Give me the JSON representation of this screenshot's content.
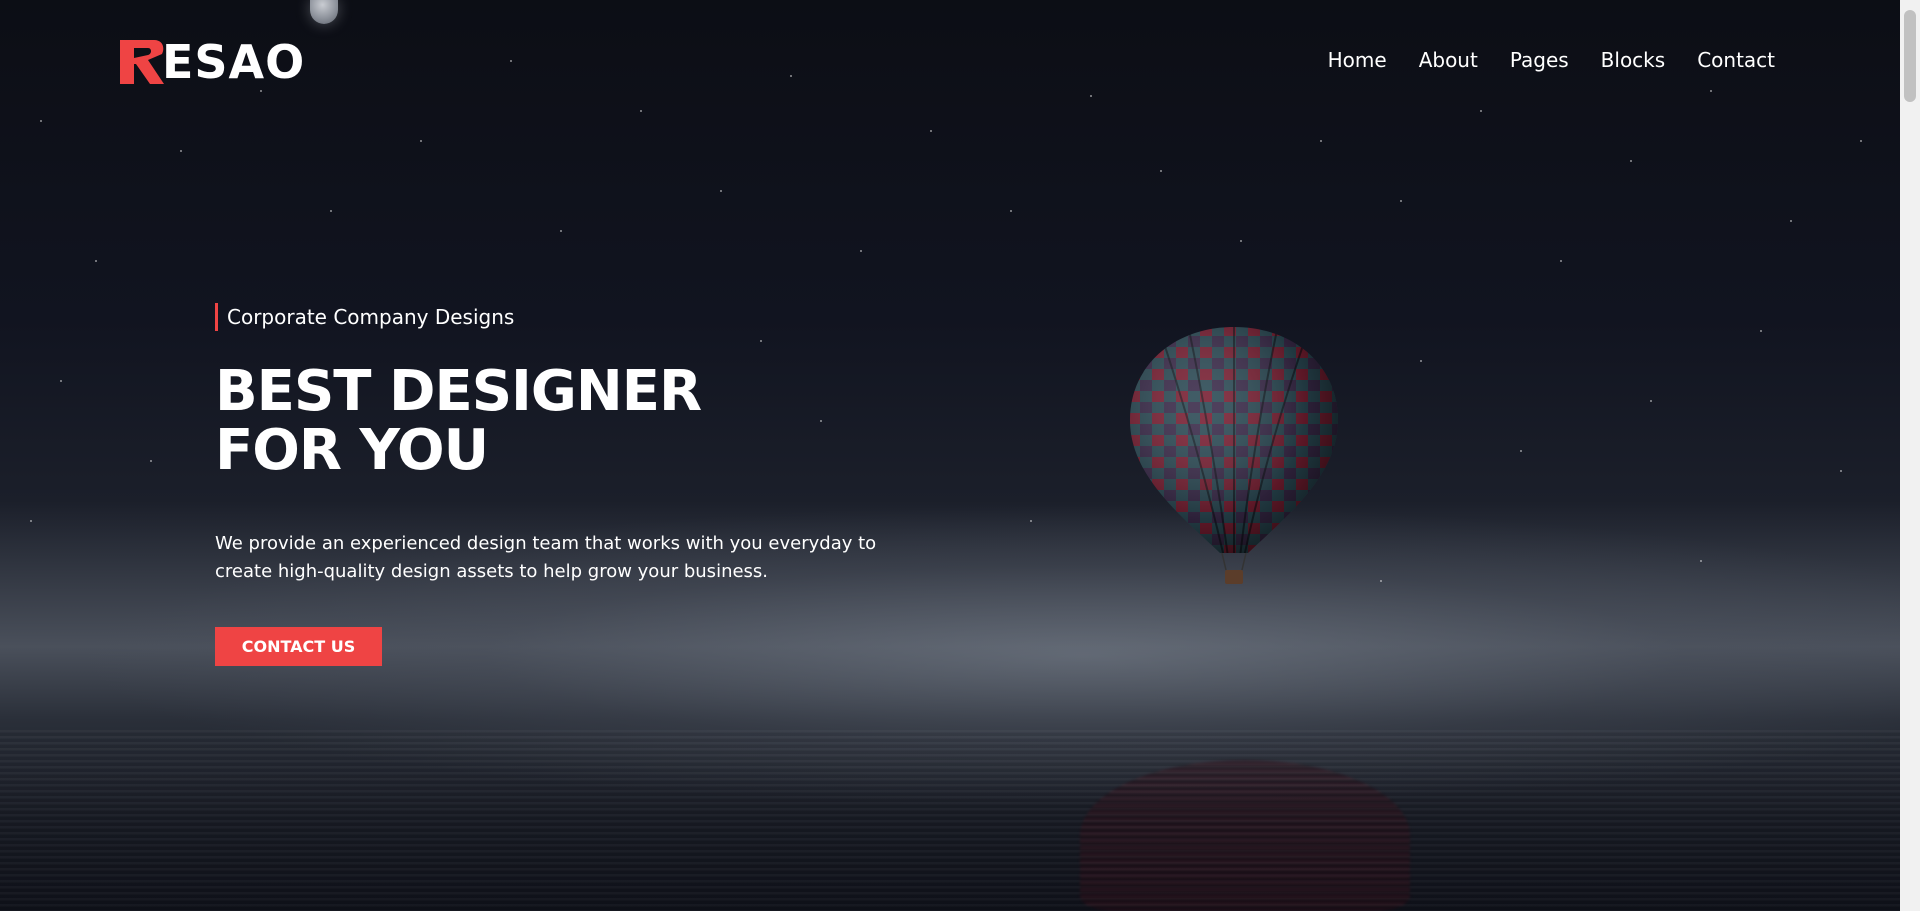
{
  "brand": {
    "logo_text": "ESAO",
    "logo_mark": "R",
    "accent_color": "#ef4444"
  },
  "nav": {
    "items": [
      "Home",
      "About",
      "Pages",
      "Blocks",
      "Contact"
    ]
  },
  "hero": {
    "tagline": "Corporate Company Designs",
    "headline_line1": "BEST DESIGNER",
    "headline_line2": "FOR YOU",
    "description": "We provide an experienced design team that works with you everyday to create high-quality design assets to help grow your business.",
    "cta_label": "CONTACT US"
  },
  "icons": {
    "moon": "moon-icon",
    "balloon": "hot-air-balloon-icon"
  }
}
